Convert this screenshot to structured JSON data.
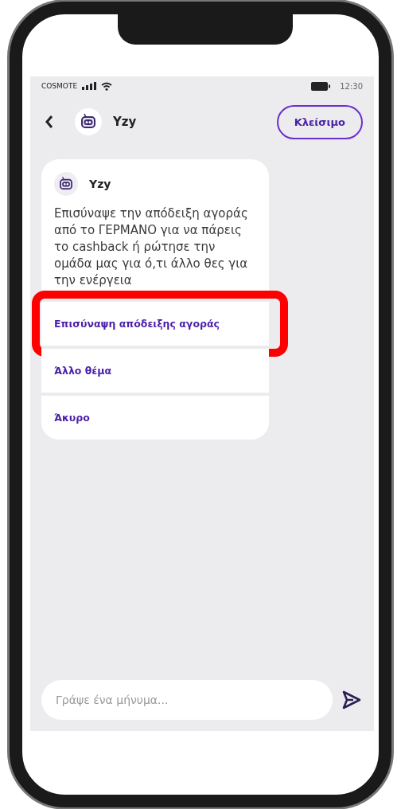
{
  "status_bar": {
    "carrier": "COSMOTE",
    "time": "12:30"
  },
  "header": {
    "title": "Yzy",
    "close_button": "Κλείσιμο"
  },
  "message": {
    "sender": "Yzy",
    "text": "Επισύναψε την απόδειξη αγοράς από το ΓΕΡΜΑΝΟ για να πάρεις το cashback ή ρώτησε την ομάδα μας για ό,τι άλλο θες για την ενέργεια"
  },
  "options": [
    {
      "label": "Επισύναψη απόδειξης αγοράς",
      "highlighted": true
    },
    {
      "label": "Άλλο θέμα",
      "highlighted": false
    },
    {
      "label": "Άκυρο",
      "highlighted": false
    }
  ],
  "composer": {
    "placeholder": "Γράψε ένα μήνυμα..."
  }
}
